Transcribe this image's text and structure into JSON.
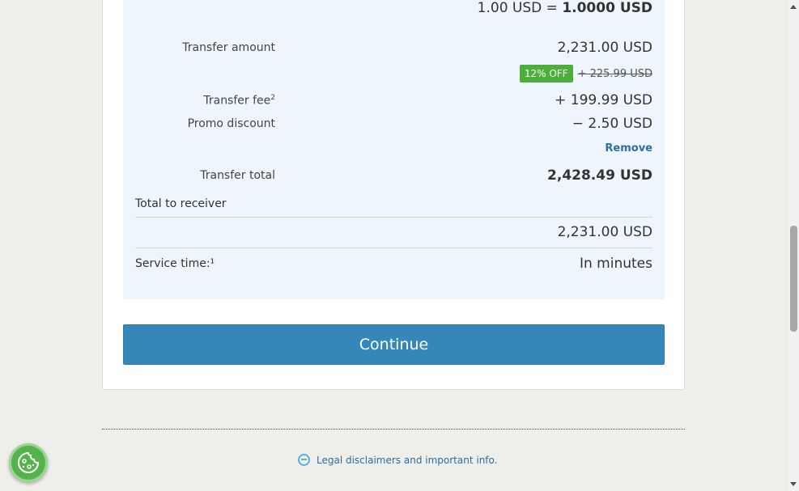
{
  "summary": {
    "rate_prefix": "1.00 USD = ",
    "rate_value": "1.0000 USD",
    "transfer_amount_label": "Transfer amount",
    "transfer_amount_value": "2,231.00 USD",
    "discount_badge": "12% OFF",
    "original_fee": "+ 225.99 USD",
    "transfer_fee_label": "Transfer fee",
    "transfer_fee_footnote": "2",
    "transfer_fee_value": "+ 199.99 USD",
    "promo_label": "Promo discount",
    "promo_value": "− 2.50 USD",
    "remove_label": "Remove",
    "transfer_total_label": "Transfer total",
    "transfer_total_value": "2,428.49 USD",
    "total_receiver_label": "Total  to receiver",
    "total_receiver_value": "2,231.00 USD",
    "service_time_label": "Service time:¹",
    "service_time_value": "In minutes"
  },
  "actions": {
    "continue_label": "Continue"
  },
  "footer": {
    "legal_link": "Legal disclaimers and important info."
  },
  "colors": {
    "accent": "#3587ba",
    "badge": "#4caf3a",
    "summary_bg": "#eff5fc",
    "link": "#2b6fa3"
  },
  "icons": {
    "legal": "minus-circle-icon",
    "cookie": "cookie-icon"
  }
}
